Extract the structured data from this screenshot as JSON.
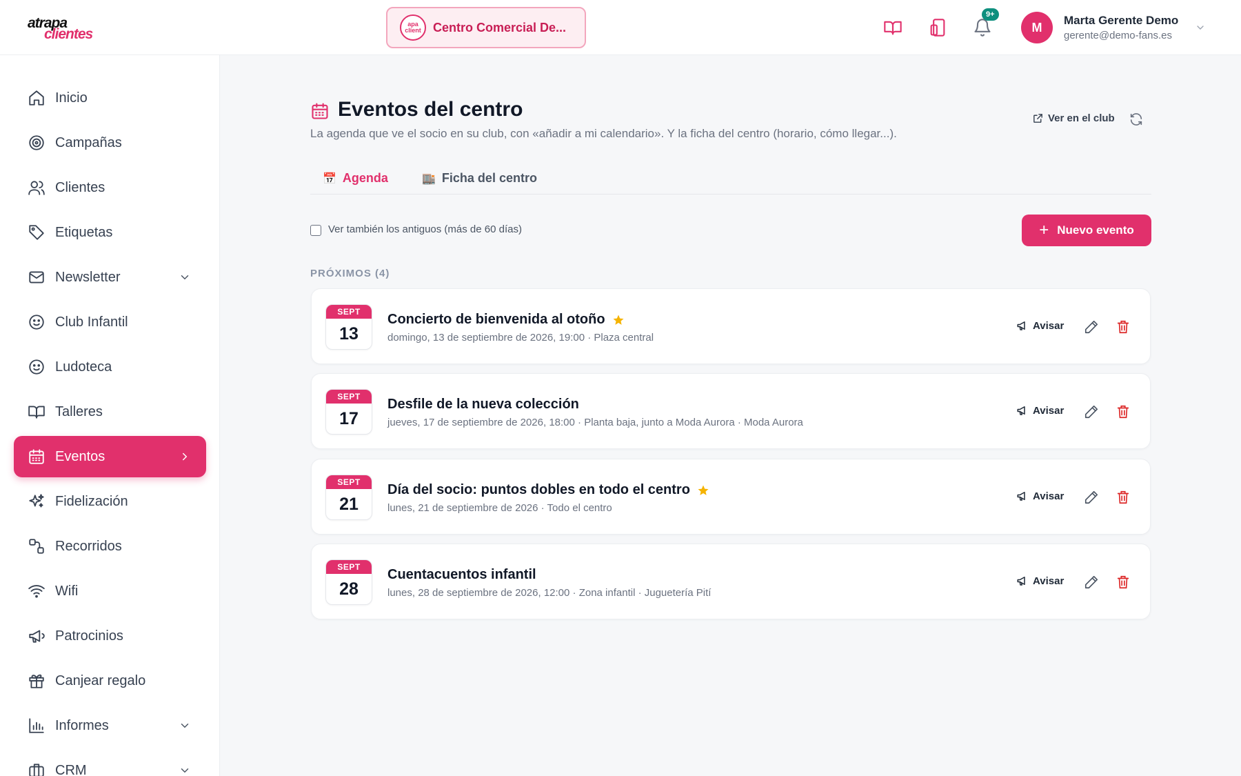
{
  "header": {
    "logo_line1": "atrapa",
    "logo_line2": "clientes",
    "center_logo_text": "apa client",
    "center_name": "Centro Comercial De...",
    "notifications_badge": "9+",
    "user": {
      "initial": "M",
      "name": "Marta Gerente Demo",
      "email": "gerente@demo-fans.es"
    },
    "icons": [
      "book-icon",
      "devices-icon",
      "bell-icon"
    ]
  },
  "sidebar": {
    "items": [
      {
        "label": "Inicio",
        "icon": "home-icon"
      },
      {
        "label": "Campañas",
        "icon": "target-icon"
      },
      {
        "label": "Clientes",
        "icon": "users-icon"
      },
      {
        "label": "Etiquetas",
        "icon": "tag-icon"
      },
      {
        "label": "Newsletter",
        "icon": "mail-icon",
        "expandable": true
      },
      {
        "label": "Club Infantil",
        "icon": "smile-icon"
      },
      {
        "label": "Ludoteca",
        "icon": "smile-icon"
      },
      {
        "label": "Talleres",
        "icon": "book-icon"
      },
      {
        "label": "Eventos",
        "icon": "calendar-icon",
        "active": true
      },
      {
        "label": "Fidelización",
        "icon": "sparkles-icon"
      },
      {
        "label": "Recorridos",
        "icon": "route-icon"
      },
      {
        "label": "Wifi",
        "icon": "wifi-icon"
      },
      {
        "label": "Patrocinios",
        "icon": "megaphone-icon"
      },
      {
        "label": "Canjear regalo",
        "icon": "gift-icon"
      },
      {
        "label": "Informes",
        "icon": "chart-icon",
        "expandable": true
      },
      {
        "label": "CRM",
        "icon": "briefcase-icon",
        "expandable": true
      }
    ]
  },
  "page": {
    "title": "Eventos del centro",
    "subtitle": "La agenda que ve el socio en su club, con «añadir a mi calendario». Y la ficha del centro (horario, cómo llegar...).",
    "ver_en_club": "Ver en el club",
    "tabs": [
      {
        "emoji": "📅",
        "label": "Agenda",
        "active": true
      },
      {
        "emoji": "🏬",
        "label": "Ficha del centro",
        "active": false
      }
    ],
    "show_old_label": "Ver también los antiguos (más de 60 días)",
    "new_event_label": "Nuevo evento",
    "section_label": "PRÓXIMOS (4)"
  },
  "events": [
    {
      "month": "SEPT",
      "day": "13",
      "title": "Concierto de bienvenida al otoño",
      "featured": true,
      "meta": "domingo, 13 de septiembre de 2026, 19:00 · Plaza central",
      "notify_label": "Avisar"
    },
    {
      "month": "SEPT",
      "day": "17",
      "title": "Desfile de la nueva colección",
      "featured": false,
      "meta": "jueves, 17 de septiembre de 2026, 18:00 · Planta baja, junto a Moda Aurora · Moda Aurora",
      "notify_label": "Avisar"
    },
    {
      "month": "SEPT",
      "day": "21",
      "title": "Día del socio: puntos dobles en todo el centro",
      "featured": true,
      "meta": "lunes, 21 de septiembre de 2026 · Todo el centro",
      "notify_label": "Avisar"
    },
    {
      "month": "SEPT",
      "day": "28",
      "title": "Cuentacuentos infantil",
      "featured": false,
      "meta": "lunes, 28 de septiembre de 2026, 12:00 · Zona infantil · Juguetería Pití",
      "notify_label": "Avisar"
    }
  ],
  "colors": {
    "brand": "#e1306c",
    "badge": "#0e8f7e",
    "star": "#f5b301",
    "danger": "#dc2626"
  }
}
